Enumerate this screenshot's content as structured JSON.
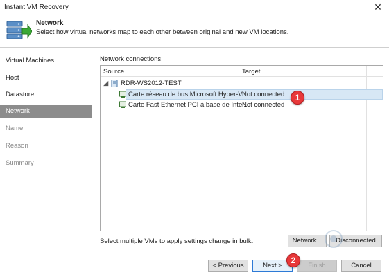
{
  "window": {
    "title": "Instant VM Recovery"
  },
  "header": {
    "title": "Network",
    "description": "Select how virtual networks map to each other between original and new VM locations."
  },
  "sidebar": {
    "items": [
      {
        "label": "Virtual Machines",
        "state": "done"
      },
      {
        "label": "Host",
        "state": "done"
      },
      {
        "label": "Datastore",
        "state": "done"
      },
      {
        "label": "Network",
        "state": "active"
      },
      {
        "label": "Name",
        "state": "pending"
      },
      {
        "label": "Reason",
        "state": "pending"
      },
      {
        "label": "Summary",
        "state": "pending"
      }
    ]
  },
  "main": {
    "connections_label": "Network connections:",
    "columns": {
      "source": "Source",
      "target": "Target"
    },
    "vm": {
      "name": "RDR-WS2012-TEST"
    },
    "adapters": [
      {
        "source": "Carte réseau de bus Microsoft Hyper-V",
        "target": "Not connected",
        "selected": true
      },
      {
        "source": "Carte Fast Ethernet PCI à base de Intel...",
        "target": "Not connected",
        "selected": false
      }
    ],
    "hint": "Select multiple VMs to apply settings change in bulk.",
    "network_button": "Network...",
    "disconnected_button": "Disconnected"
  },
  "footer": {
    "previous": "< Previous",
    "next": "Next >",
    "finish": "Finish",
    "cancel": "Cancel"
  },
  "callouts": {
    "one": "1",
    "two": "2"
  },
  "colors": {
    "active_step": "#8c8c8c",
    "selection": "#d7e7f5",
    "callout": "#e8383a",
    "primary_border": "#2d7ad6"
  }
}
